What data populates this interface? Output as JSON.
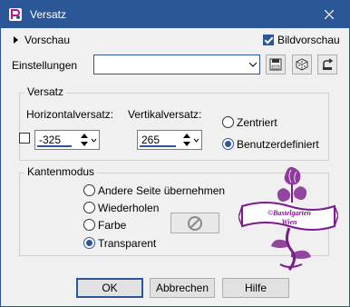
{
  "window": {
    "title": "Versatz"
  },
  "header": {
    "preview_label": "Vorschau",
    "image_preview_label": "Bildvorschau",
    "image_preview_checked": true
  },
  "settings": {
    "label": "Einstellungen",
    "value": ""
  },
  "offset_group": {
    "title": "Versatz",
    "horizontal_label": "Horizontalversatz:",
    "horizontal_value": "-325",
    "vertical_label": "Vertikalversatz:",
    "vertical_value": "265",
    "centered_label": "Zentriert",
    "custom_label": "Benutzerdefiniert",
    "selected": "custom"
  },
  "edge_group": {
    "title": "Kantenmodus",
    "options": [
      "Andere Seite übernehmen",
      "Wiederholen",
      "Farbe",
      "Transparent"
    ],
    "selected": "Transparent"
  },
  "logo": {
    "line1": "©Bastelgarten",
    "line2": "Wien"
  },
  "buttons": {
    "ok": "OK",
    "cancel": "Abbrechen",
    "help": "Hilfe"
  },
  "colors": {
    "accent": "#2b5797",
    "logo_purple": "#7b1c8c"
  }
}
